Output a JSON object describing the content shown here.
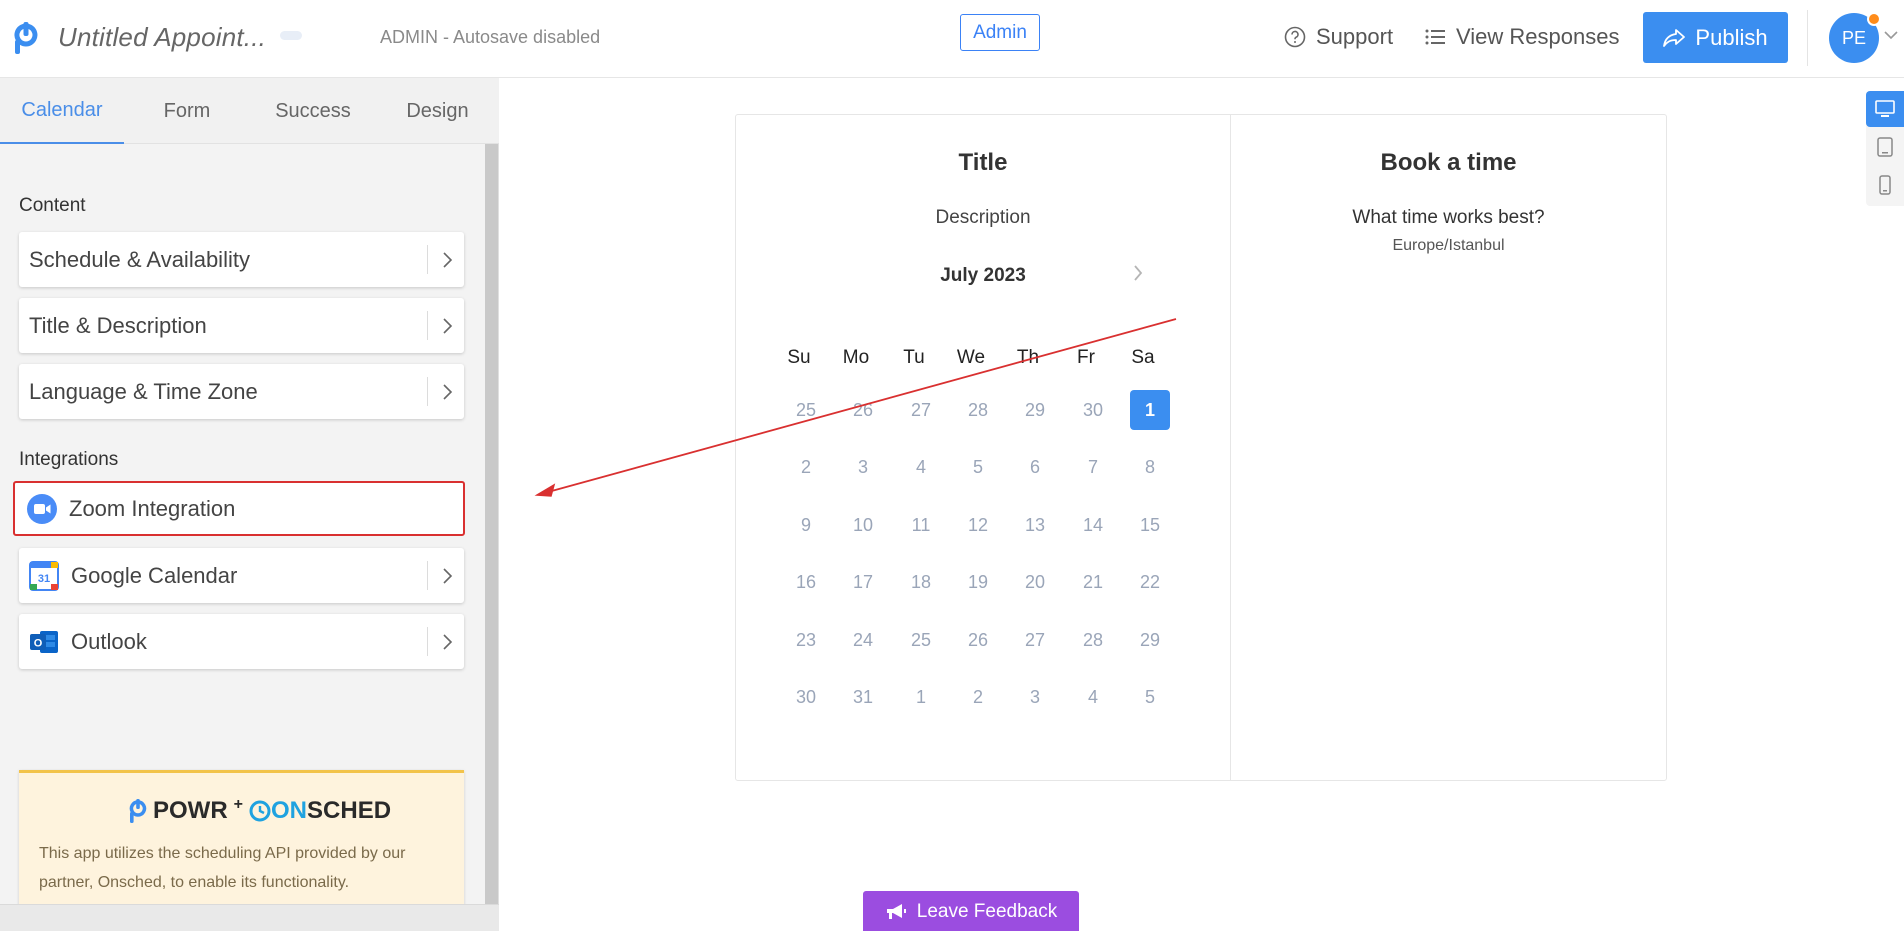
{
  "header": {
    "app_title": "Untitled Appoint...",
    "autosave_status": "ADMIN - Autosave disabled",
    "admin_badge": "Admin",
    "support_label": "Support",
    "view_responses_label": "View Responses",
    "publish_label": "Publish",
    "avatar_initials": "PE"
  },
  "sidebar": {
    "tabs": [
      {
        "label": "Calendar",
        "active": true
      },
      {
        "label": "Form",
        "active": false
      },
      {
        "label": "Success",
        "active": false
      },
      {
        "label": "Design",
        "active": false
      }
    ],
    "content_label": "Content",
    "content_items": [
      {
        "label": "Schedule & Availability"
      },
      {
        "label": "Title & Description"
      },
      {
        "label": "Language & Time Zone"
      }
    ],
    "integrations_label": "Integrations",
    "integration_items": [
      {
        "label": "Zoom Integration",
        "icon": "zoom-icon",
        "highlighted": true
      },
      {
        "label": "Google Calendar",
        "icon": "google-calendar-icon",
        "icon_text": "31"
      },
      {
        "label": "Outlook",
        "icon": "outlook-icon",
        "icon_text": "O"
      }
    ],
    "partner": {
      "brand_a": "POWR",
      "plus": "+",
      "brand_b_a": "ON",
      "brand_b_b": "SCHED",
      "text": "This app utilizes the scheduling API provided by our partner, Onsched, to enable its functionality."
    }
  },
  "calendar": {
    "title": "Title",
    "description": "Description",
    "month": "July 2023",
    "weekdays": [
      "Su",
      "Mo",
      "Tu",
      "We",
      "Th",
      "Fr",
      "Sa"
    ],
    "weeks": [
      [
        "25",
        "26",
        "27",
        "28",
        "29",
        "30",
        "1"
      ],
      [
        "2",
        "3",
        "4",
        "5",
        "6",
        "7",
        "8"
      ],
      [
        "9",
        "10",
        "11",
        "12",
        "13",
        "14",
        "15"
      ],
      [
        "16",
        "17",
        "18",
        "19",
        "20",
        "21",
        "22"
      ],
      [
        "23",
        "24",
        "25",
        "26",
        "27",
        "28",
        "29"
      ],
      [
        "30",
        "31",
        "1",
        "2",
        "3",
        "4",
        "5"
      ]
    ],
    "selected_day": "1"
  },
  "booking": {
    "title": "Book a time",
    "question": "What time works best?",
    "timezone": "Europe/Istanbul"
  },
  "feedback_label": "Leave Feedback",
  "colors": {
    "accent": "#3b8ef0",
    "annotation": "#d93030",
    "feedback": "#9b4de0"
  }
}
